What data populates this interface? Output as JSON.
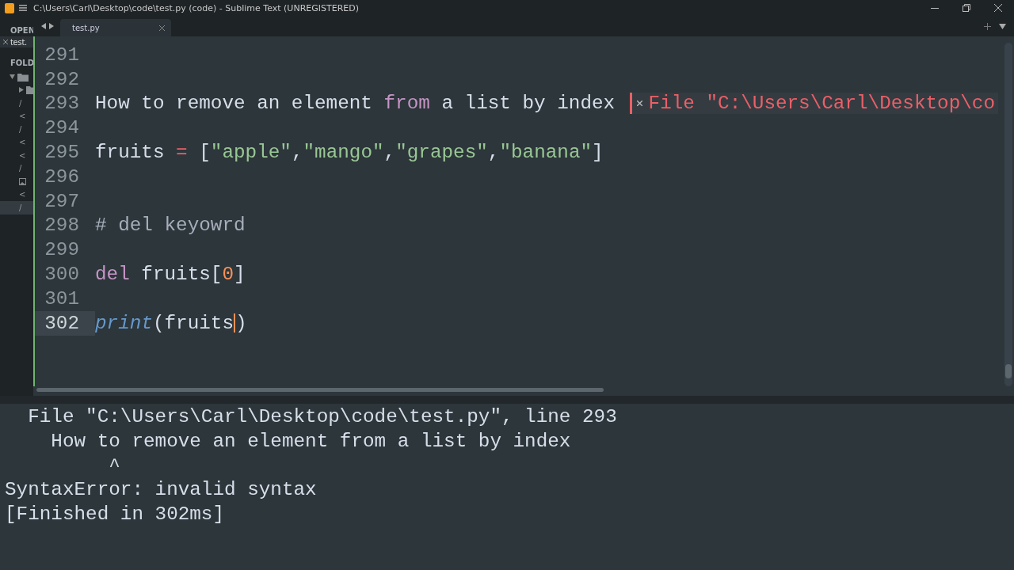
{
  "window": {
    "title": "C:\\Users\\Carl\\Desktop\\code\\test.py (code) - Sublime Text (UNREGISTERED)"
  },
  "sidebar": {
    "open_label": "OPEN",
    "open_files": [
      {
        "name": "test."
      }
    ],
    "folders_label": "FOLD",
    "items": [
      {
        "kind": "folder",
        "expanded": true,
        "selected": false,
        "children": [
          {
            "kind": "folder",
            "expanded": false,
            "selected": false
          },
          {
            "kind": "file",
            "name": "/",
            "selected": false
          },
          {
            "kind": "file",
            "name": "<",
            "selected": false
          },
          {
            "kind": "file",
            "name": "/",
            "selected": false
          },
          {
            "kind": "file",
            "name": "<",
            "selected": false
          },
          {
            "kind": "file",
            "name": "<",
            "selected": false
          },
          {
            "kind": "file",
            "name": "/",
            "selected": false
          },
          {
            "kind": "image",
            "selected": false
          },
          {
            "kind": "file",
            "name": "<",
            "selected": false
          },
          {
            "kind": "file",
            "name": "/",
            "selected": true
          }
        ]
      }
    ]
  },
  "tabs": [
    {
      "label": "test.py",
      "selected": true
    }
  ],
  "editor": {
    "lines": [
      {
        "number": "291"
      },
      {
        "number": "292"
      },
      {
        "number": "293",
        "tokens": [
          {
            "text": "How to remove an element ",
            "kind": "plain"
          },
          {
            "text": "from",
            "kind": "keyword"
          },
          {
            "text": " a list by index",
            "kind": "plain"
          }
        ],
        "error": "File \"C:\\Users\\Carl\\Desktop\\co"
      },
      {
        "number": "294"
      },
      {
        "number": "295",
        "tokens": [
          {
            "text": "fruits ",
            "kind": "plain"
          },
          {
            "text": "=",
            "kind": "operator"
          },
          {
            "text": " [",
            "kind": "plain"
          },
          {
            "text": "\"apple\"",
            "kind": "string"
          },
          {
            "text": ",",
            "kind": "plain"
          },
          {
            "text": "\"mango\"",
            "kind": "string"
          },
          {
            "text": ",",
            "kind": "plain"
          },
          {
            "text": "\"grapes\"",
            "kind": "string"
          },
          {
            "text": ",",
            "kind": "plain"
          },
          {
            "text": "\"banana\"",
            "kind": "string"
          },
          {
            "text": "]",
            "kind": "plain"
          }
        ]
      },
      {
        "number": "296"
      },
      {
        "number": "297"
      },
      {
        "number": "298",
        "tokens": [
          {
            "text": "# del keyowrd",
            "kind": "comment"
          }
        ]
      },
      {
        "number": "299"
      },
      {
        "number": "300",
        "tokens": [
          {
            "text": "del",
            "kind": "keyword"
          },
          {
            "text": " fruits[",
            "kind": "plain"
          },
          {
            "text": "0",
            "kind": "number"
          },
          {
            "text": "]",
            "kind": "plain"
          }
        ]
      },
      {
        "number": "301"
      },
      {
        "number": "302",
        "current": true,
        "tokens": [
          {
            "text": "print",
            "kind": "builtin"
          },
          {
            "text": "(fruits",
            "kind": "plain"
          },
          {
            "text": ")",
            "kind": "plain"
          }
        ]
      }
    ]
  },
  "output": {
    "lines": [
      "  File \"C:\\Users\\Carl\\Desktop\\code\\test.py\", line 293",
      "    How to remove an element from a list by index",
      "         ^",
      "SyntaxError: invalid syntax",
      "[Finished in 302ms]"
    ]
  }
}
